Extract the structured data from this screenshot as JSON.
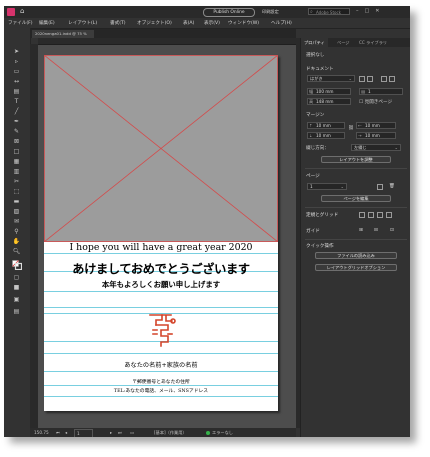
{
  "titlebar": {
    "publish_label": "Publish Online",
    "workspace_label": "印刷設定",
    "search_placeholder": "Adobe Stock"
  },
  "menubar": {
    "items": [
      "ファイル(F)",
      "編集(E)",
      "レイアウト(L)",
      "書式(T)",
      "オブジェクト(O)",
      "表(A)",
      "表示(V)",
      "ウィンドウ(W)",
      "ヘルプ(H)"
    ]
  },
  "document": {
    "tab_label": "2020nenga01.indd @ 75 %",
    "card": {
      "line1": "I hope you will have a great year 2020",
      "line2": "あけましておめでとうございます",
      "line3": "本年もよろしくお願い申し上げます",
      "names": "あなたの名前+家族の名前",
      "address": "〒郵便番号とあなたの住所",
      "tel": "TEL:あなたの電話、メール、SNSアドレス"
    }
  },
  "statusbar": {
    "zoom": "150.75",
    "page": "1",
    "profile": "[基本]（作業用）",
    "errors": "エラーなし"
  },
  "panel": {
    "tabs": [
      "プロパティ",
      "ページ",
      "CC ライブラリ"
    ],
    "no_selection": "選択なし",
    "document_section": "ドキュメント",
    "preset": "はがき",
    "width_label": "幅",
    "width": "100 mm",
    "height_label": "高",
    "height": "148 mm",
    "pages": "1",
    "facing_pages": "見開きページ",
    "margin_section": "マージン",
    "margins": [
      "10 mm",
      "10 mm",
      "10 mm",
      "10 mm"
    ],
    "binding_label": "綴じ方向：",
    "binding_value": "左綴じ",
    "adjust_layout": "レイアウトを調整",
    "page_section": "ページ",
    "page_value": "1",
    "edit_page": "ページを編集",
    "rulers_grids": "定規とグリッド",
    "guides": "ガイド",
    "quick_actions": "クイック操作",
    "import_file": "ファイルの読み込み",
    "layout_grid_options": "レイアウトグリッドオプション"
  },
  "colors": {
    "app_bg": "#323232",
    "accent_logo": "#d6336c",
    "ornament": "#d4452b",
    "guide": "#79cfe0",
    "crosshair": "#d44a4a"
  }
}
